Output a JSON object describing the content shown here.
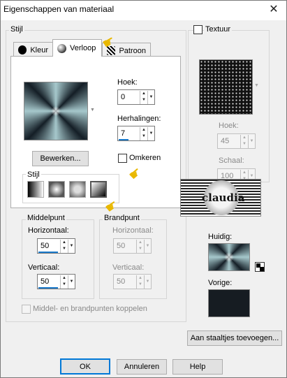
{
  "window": {
    "title": "Eigenschappen van materiaal",
    "close_glyph": "✕"
  },
  "stijl": {
    "group_title": "Stijl",
    "tabs": [
      {
        "label": "Kleur",
        "icon": "solid-color-icon"
      },
      {
        "label": "Verloop",
        "icon": "gradient-sphere-icon",
        "active": true
      },
      {
        "label": "Patroon",
        "icon": "pattern-icon"
      }
    ],
    "angle": {
      "label": "Hoek:",
      "value": "0"
    },
    "repeats": {
      "label": "Herhalingen:",
      "value": "7"
    },
    "edit_button": "Bewerken...",
    "invert": {
      "label": "Omkeren",
      "checked": false
    },
    "style_group": {
      "title": "Stijl",
      "options": [
        "linear",
        "rectangular",
        "sunburst",
        "radial"
      ],
      "selected": "radial"
    },
    "midpoint": {
      "title": "Middelpunt",
      "horizontal_label": "Horizontaal:",
      "horizontal_value": "50",
      "vertical_label": "Verticaal:",
      "vertical_value": "50"
    },
    "focalpoint": {
      "title": "Brandpunt",
      "horizontal_label": "Horizontaal:",
      "horizontal_value": "50",
      "vertical_label": "Verticaal:",
      "vertical_value": "50"
    },
    "link_points": {
      "label": "Middel- en brandpunten koppelen",
      "checked": false,
      "disabled": true
    }
  },
  "texture": {
    "checkbox_label": "Textuur",
    "checked": false,
    "angle": {
      "label": "Hoek:",
      "value": "45"
    },
    "scale": {
      "label": "Schaal:",
      "value": "100"
    }
  },
  "watermark": {
    "text": "claudia"
  },
  "current": {
    "label": "Huidig:"
  },
  "previous": {
    "label": "Vorige:"
  },
  "add_swatch_button": "Aan staaltjes toevoegen...",
  "buttons": {
    "ok": "OK",
    "cancel": "Annuleren",
    "help": "Help"
  },
  "colors": {
    "accent": "#1979ca",
    "gradient_light": "#a6c8cc",
    "gradient_dark": "#141e26",
    "pointer_hand": "#e9b800"
  }
}
